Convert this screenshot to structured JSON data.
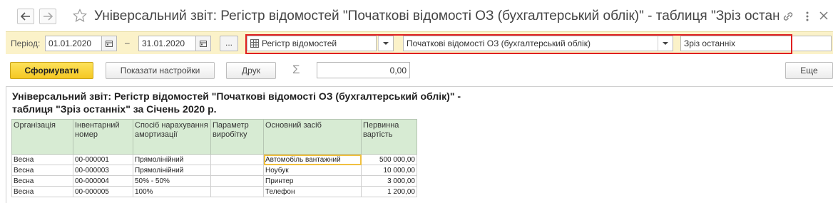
{
  "window": {
    "title": "Універсальний звіт: Регістр відомостей \"Початкові відомості ОЗ (бухгалтерський облік)\" - таблиця \"Зріз останніх\""
  },
  "params": {
    "period_label": "Період:",
    "date_from": "01.01.2020",
    "date_to": "31.01.2020",
    "dash": "–",
    "dots": "...",
    "source_type": "Регістр відомостей",
    "source_name": "Початкові відомості ОЗ (бухгалтерський облік)",
    "table_name": "Зріз останніх"
  },
  "toolbar": {
    "generate_label": "Сформувати",
    "settings_label": "Показати настройки",
    "print_label": "Друк",
    "sigma": "Σ",
    "sum_value": "0,00",
    "more_label": "Еще"
  },
  "report": {
    "title_line1": "Універсальний звіт: Регістр відомостей \"Початкові відомості ОЗ (бухгалтерський облік)\" -",
    "title_line2": "таблиця \"Зріз останніх\" за Січень 2020 р.",
    "columns": [
      "Організація",
      "Інвентарний номер",
      "Спосіб нарахування амортизації",
      "Параметр виробітку",
      "Основний засіб",
      "Первинна вартість"
    ],
    "rows": [
      [
        "Весна",
        "00-000001",
        "Прямолінійний",
        "",
        "Автомобіль вантажний",
        "500 000,00"
      ],
      [
        "Весна",
        "00-000003",
        "Прямолінійний",
        "",
        "Ноубук",
        "10 000,00"
      ],
      [
        "Весна",
        "00-000004",
        "50% - 50%",
        "",
        "Принтер",
        "3 000,00"
      ],
      [
        "Весна",
        "00-000005",
        "100%",
        "",
        "Телефон",
        "1 200,00"
      ]
    ]
  },
  "colors": {
    "param_bar": "#fbf2c9",
    "primary_button": "#f5c823",
    "header_fill": "#d7ebd3",
    "highlight_frame": "#e02020"
  }
}
